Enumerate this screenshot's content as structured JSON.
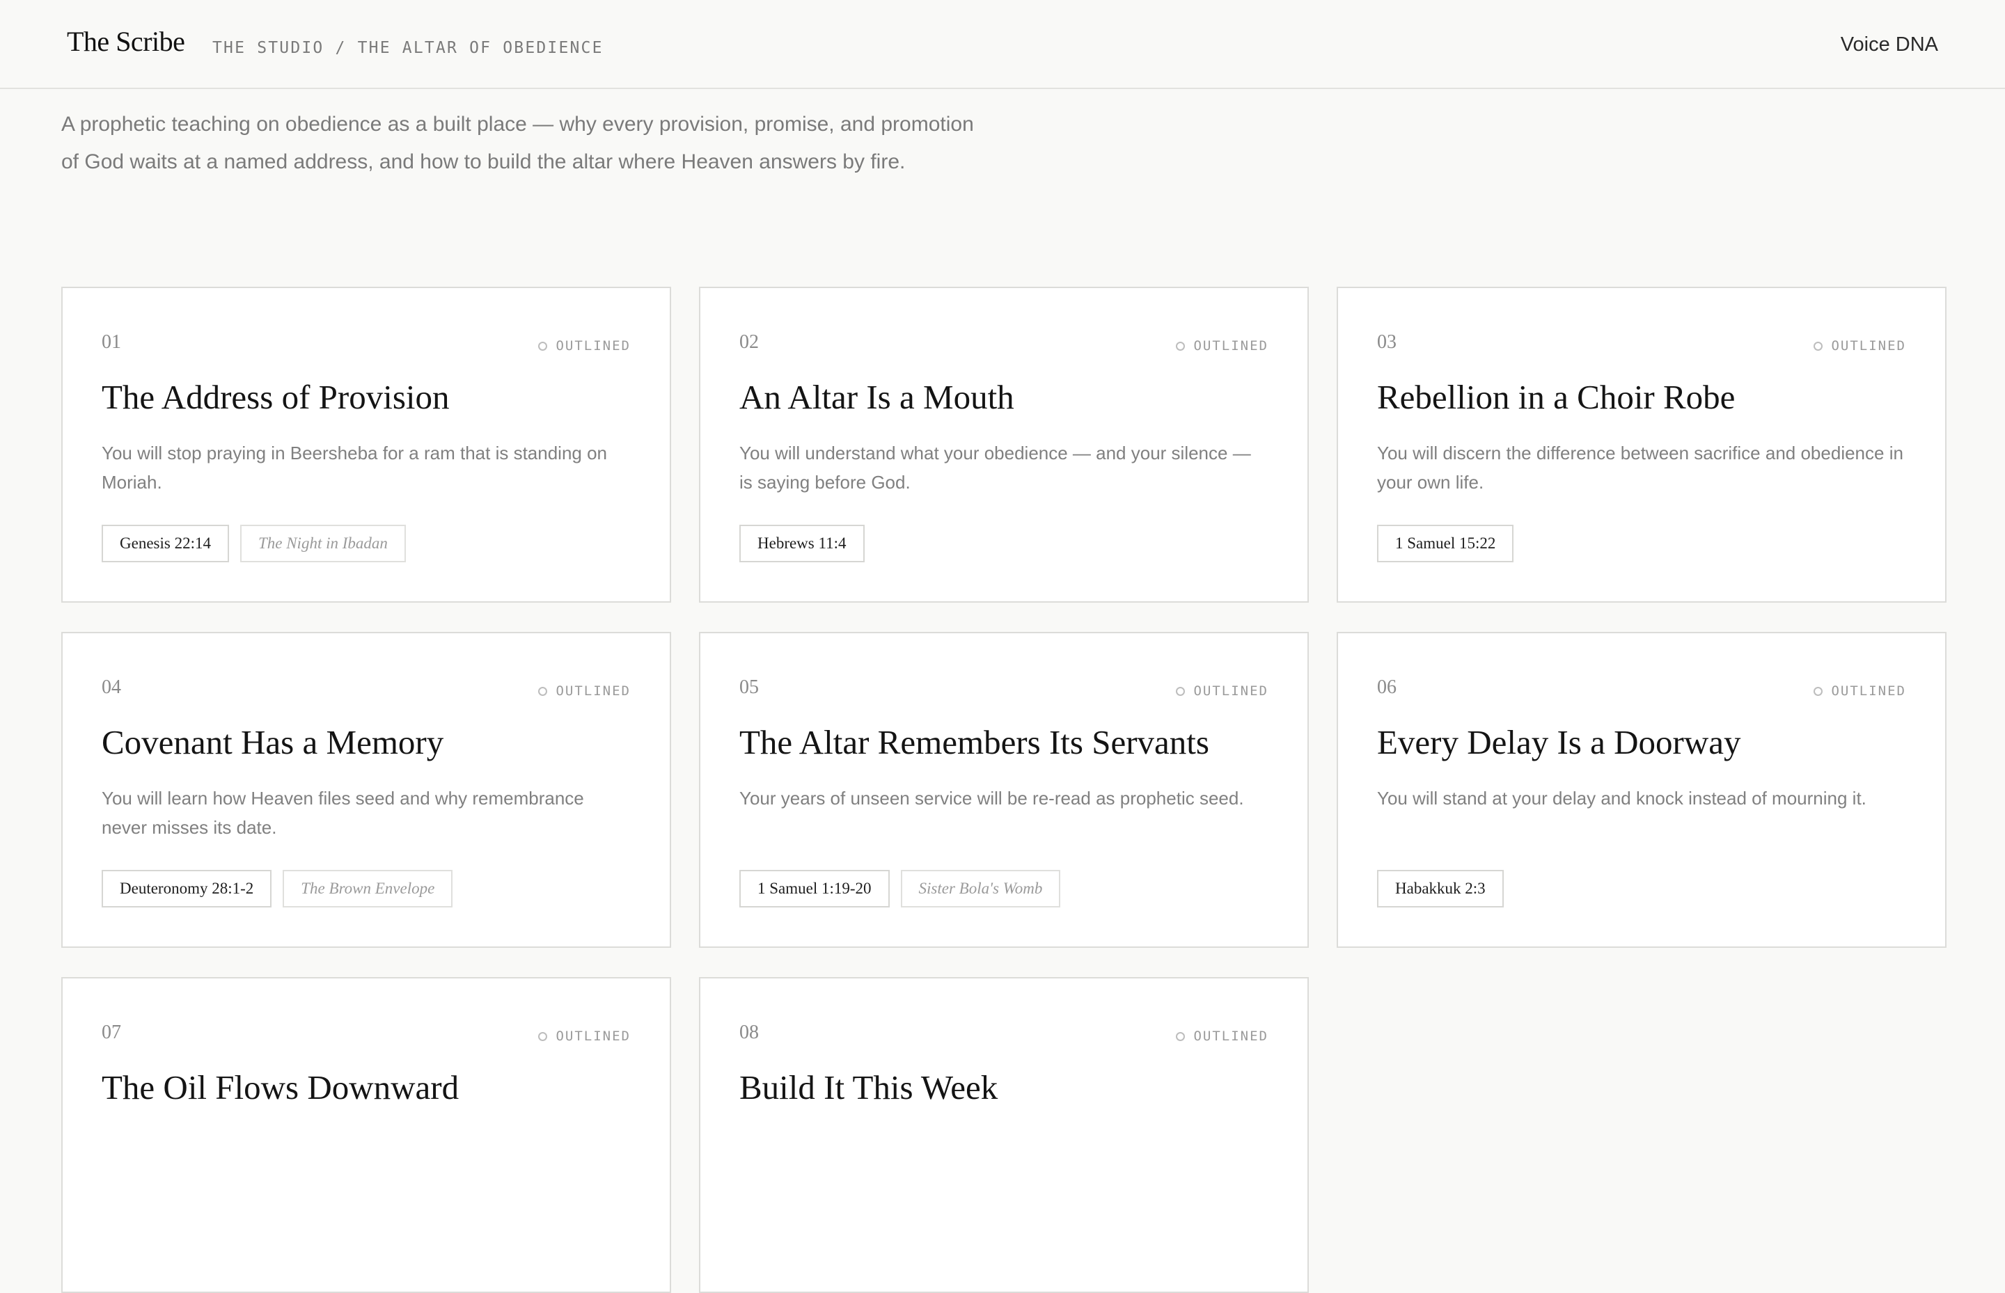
{
  "header": {
    "brand": "The Scribe",
    "breadcrumb": "THE STUDIO / THE ALTAR OF OBEDIENCE",
    "nav_link": "Voice DNA"
  },
  "intro": "A prophetic teaching on obedience as a built place — why every provision, promise, and promotion of God waits at a named address, and how to build the altar where Heaven answers by fire.",
  "cards": [
    {
      "number": "01",
      "status": "OUTLINED",
      "title": "The Address of Provision",
      "description": "You will stop praying in Beersheba for a ram that is standing on Moriah.",
      "scripture": "Genesis 22:14",
      "story": "The Night in Ibadan"
    },
    {
      "number": "02",
      "status": "OUTLINED",
      "title": "An Altar Is a Mouth",
      "description": "You will understand what your obedience — and your silence — is saying before God.",
      "scripture": "Hebrews 11:4",
      "story": ""
    },
    {
      "number": "03",
      "status": "OUTLINED",
      "title": "Rebellion in a Choir Robe",
      "description": "You will discern the difference between sacrifice and obedience in your own life.",
      "scripture": "1 Samuel 15:22",
      "story": ""
    },
    {
      "number": "04",
      "status": "OUTLINED",
      "title": "Covenant Has a Memory",
      "description": "You will learn how Heaven files seed and why remembrance never misses its date.",
      "scripture": "Deuteronomy 28:1-2",
      "story": "The Brown Envelope"
    },
    {
      "number": "05",
      "status": "OUTLINED",
      "title": "The Altar Remembers Its Servants",
      "description": "Your years of unseen service will be re-read as prophetic seed.",
      "scripture": "1 Samuel 1:19-20",
      "story": "Sister Bola's Womb"
    },
    {
      "number": "06",
      "status": "OUTLINED",
      "title": "Every Delay Is a Doorway",
      "description": "You will stand at your delay and knock instead of mourning it.",
      "scripture": "Habakkuk 2:3",
      "story": ""
    },
    {
      "number": "07",
      "status": "OUTLINED",
      "title": "The Oil Flows Downward",
      "description": "",
      "scripture": "",
      "story": ""
    },
    {
      "number": "08",
      "status": "OUTLINED",
      "title": "Build It This Week",
      "description": "",
      "scripture": "",
      "story": ""
    }
  ]
}
